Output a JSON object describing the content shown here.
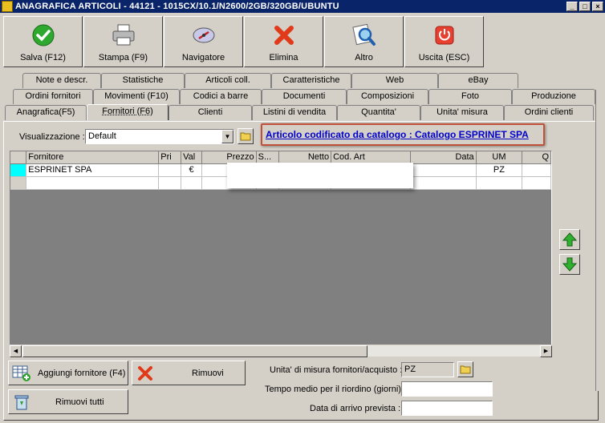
{
  "window": {
    "title": "ANAGRAFICA ARTICOLI - 44121 - 1015CX/10.1/N2600/2GB/320GB/UBUNTU"
  },
  "toolbar": [
    {
      "label": "Salva (F12)",
      "icon": "check-icon"
    },
    {
      "label": "Stampa (F9)",
      "icon": "printer-icon"
    },
    {
      "label": "Navigatore",
      "icon": "compass-icon"
    },
    {
      "label": "Elimina",
      "icon": "delete-x-icon"
    },
    {
      "label": "Altro",
      "icon": "search-document-icon"
    },
    {
      "label": "Uscita (ESC)",
      "icon": "power-icon"
    }
  ],
  "tabs": {
    "row1": [
      "Note e descr.",
      "Statistiche",
      "Articoli coll.",
      "Caratteristiche",
      "Web",
      "eBay"
    ],
    "row2": [
      "Ordini fornitori",
      "Movimenti (F10)",
      "Codici a barre",
      "Documenti",
      "Composizioni",
      "Foto",
      "Produzione"
    ],
    "row3": [
      "Anagrafica(F5)",
      "Fornitori (F6)",
      "Clienti",
      "Listini di vendita",
      "Quantita'",
      "Unita' misura",
      "Ordini clienti"
    ]
  },
  "view": {
    "label": "Visualizzazione :",
    "value": "Default"
  },
  "catalog_link": "Articolo codificato da catalogo : Catalogo ESPRINET SPA",
  "grid": {
    "columns": [
      "Fornitore",
      "Pri",
      "Val",
      "Prezzo",
      "S...",
      "Netto",
      "Cod. Art",
      "Data",
      "UM",
      "Q"
    ],
    "rows": [
      [
        "ESPRINET SPA",
        "",
        "€",
        "",
        "",
        "",
        "",
        "",
        "PZ",
        ""
      ]
    ]
  },
  "buttons": {
    "add_supplier": "Aggiungi fornitore (F4)",
    "remove": "Rimuovi",
    "remove_all": "Rimuovi tutti"
  },
  "fields": {
    "uom_label": "Unita' di misura fornitori/acquisto :",
    "uom_value": "PZ",
    "reorder_label": "Tempo medio per il riordino (giorni) :",
    "reorder_value": "",
    "arrival_label": "Data di arrivo prevista :",
    "arrival_value": ""
  }
}
